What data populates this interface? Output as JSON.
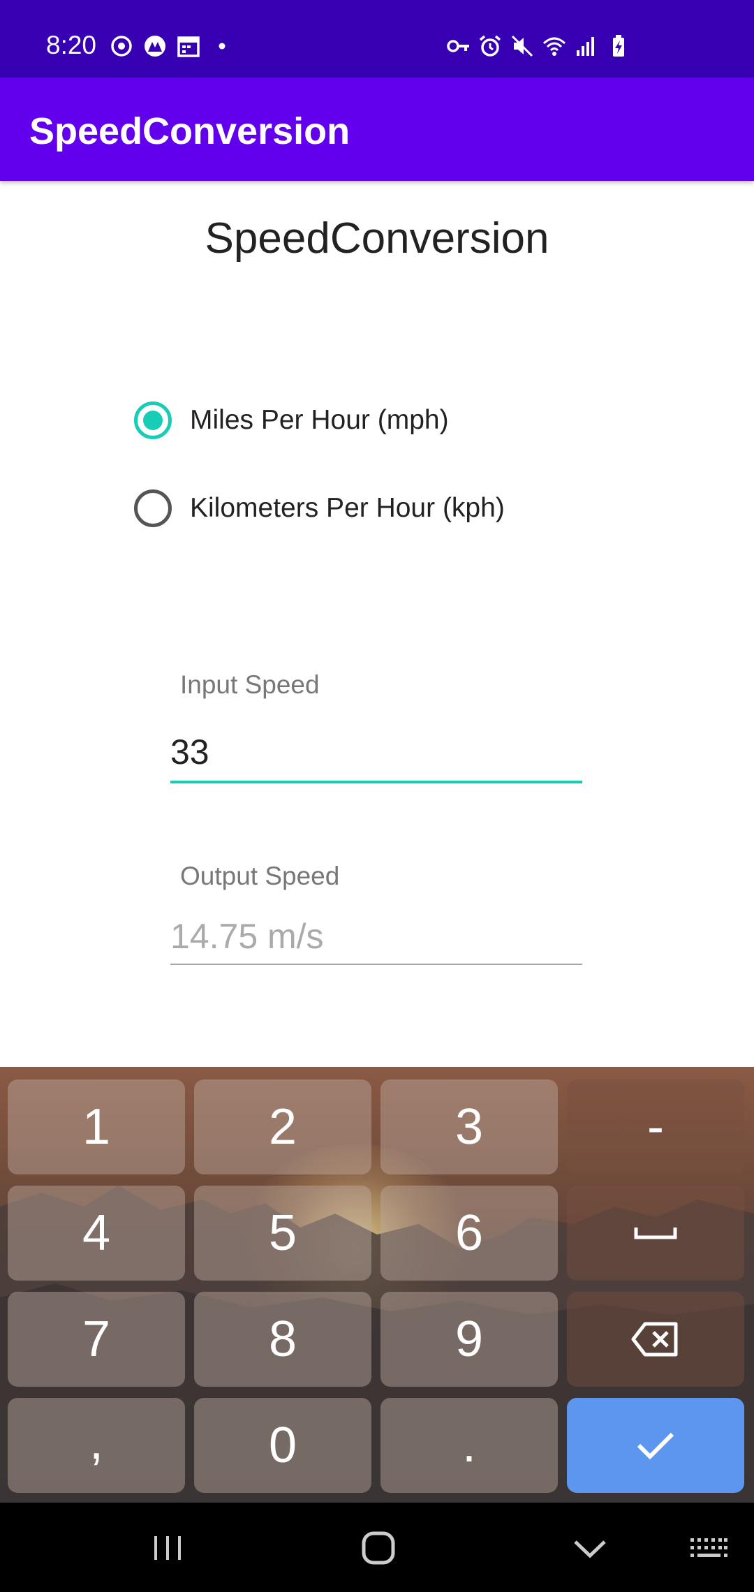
{
  "status_bar": {
    "time": "8:20",
    "left_icons": [
      "sync-icon",
      "app-notification-icon",
      "calendar-icon",
      "dot-icon"
    ],
    "right_icons": [
      "vpn-key-icon",
      "alarm-icon",
      "mute-icon",
      "wifi-icon",
      "signal-icon",
      "battery-charging-icon"
    ]
  },
  "app_bar": {
    "title": "SpeedConversion"
  },
  "main": {
    "title": "SpeedConversion",
    "radio_options": [
      {
        "label": "Miles Per Hour (mph)",
        "checked": true
      },
      {
        "label": "Kilometers Per Hour (kph)",
        "checked": false
      }
    ],
    "input_speed": {
      "label": "Input Speed",
      "value": "33"
    },
    "output_speed": {
      "label": "Output Speed",
      "value": "14.75 m/s"
    }
  },
  "keyboard": {
    "keys": [
      "1",
      "2",
      "3",
      "-",
      "4",
      "5",
      "6",
      "space",
      "7",
      "8",
      "9",
      "backspace",
      ",",
      "0",
      ".",
      "done"
    ],
    "accent": "#5c96ee"
  },
  "nav_bar": {
    "buttons": [
      "recent-apps-icon",
      "home-icon",
      "back-down-icon",
      "keyboard-icon"
    ]
  },
  "colors": {
    "status_bar": "#3700b3",
    "app_bar": "#6200ee",
    "accent": "#18cdb6"
  }
}
